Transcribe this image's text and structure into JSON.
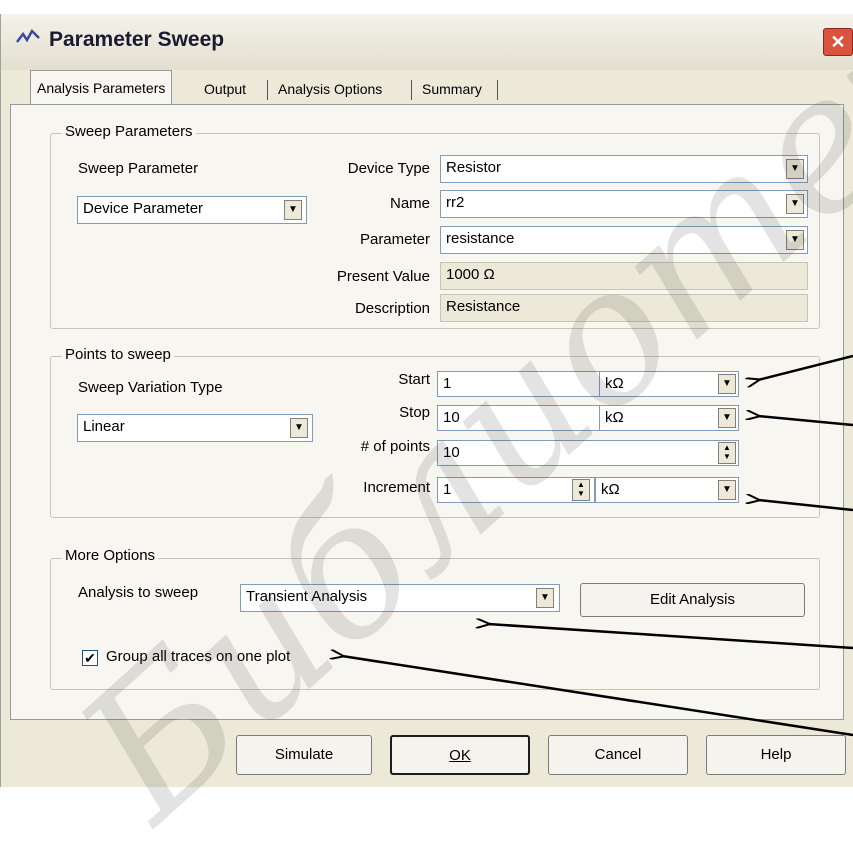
{
  "window": {
    "title": "Parameter Sweep",
    "close_glyph": "✕"
  },
  "tabs": [
    {
      "label": "Analysis Parameters",
      "active": true
    },
    {
      "label": "Output"
    },
    {
      "label": "Analysis Options"
    },
    {
      "label": "Summary"
    }
  ],
  "sweep_parameters": {
    "legend": "Sweep Parameters",
    "sweep_parameter_label": "Sweep Parameter",
    "sweep_parameter_value": "Device Parameter",
    "device_type_label": "Device Type",
    "device_type_value": "Resistor",
    "name_label": "Name",
    "name_value": "rr2",
    "parameter_label": "Parameter",
    "parameter_value": "resistance",
    "present_value_label": "Present Value",
    "present_value_value": "1000 Ω",
    "description_label": "Description",
    "description_value": "Resistance"
  },
  "points_to_sweep": {
    "legend": "Points to sweep",
    "variation_type_label": "Sweep Variation Type",
    "variation_type_value": "Linear",
    "start_label": "Start",
    "start_value": "1",
    "start_unit": "kΩ",
    "stop_label": "Stop",
    "stop_value": "10",
    "stop_unit": "kΩ",
    "points_label": "# of points",
    "points_value": "10",
    "increment_label": "Increment",
    "increment_value": "1",
    "increment_unit": "kΩ"
  },
  "more_options": {
    "legend": "More Options",
    "analysis_label": "Analysis to sweep",
    "analysis_value": "Transient Analysis",
    "edit_button": "Edit Analysis",
    "group_traces_label": "Group all traces on one plot",
    "group_traces_checked": true
  },
  "buttons": {
    "simulate": "Simulate",
    "ok": "OK",
    "cancel": "Cancel",
    "help": "Help"
  },
  "watermark": "Библиотека",
  "colors": {
    "accent": "#1c5180",
    "panel": "#f7f6f0",
    "window": "#ece9d8"
  }
}
